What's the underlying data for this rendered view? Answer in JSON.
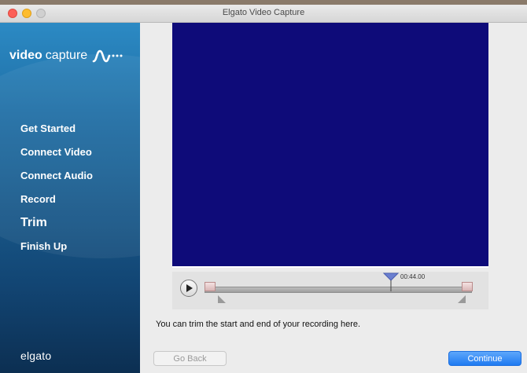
{
  "window": {
    "title": "Elgato Video Capture"
  },
  "brand": {
    "bold": "video",
    "light": "capture"
  },
  "sidebar": {
    "items": [
      {
        "label": "Get Started"
      },
      {
        "label": "Connect Video"
      },
      {
        "label": "Connect Audio"
      },
      {
        "label": "Record"
      },
      {
        "label": "Trim",
        "active": true
      },
      {
        "label": "Finish Up"
      }
    ],
    "logo": "elgato"
  },
  "video": {
    "color": "#0e0b79"
  },
  "trim": {
    "playhead_time": "00:44.00"
  },
  "hint": "You can trim the start and end of your recording here.",
  "buttons": {
    "back": "Go Back",
    "continue": "Continue"
  },
  "colors": {
    "accent": "#1f7af1",
    "sidebar_top": "#2c8ac4",
    "sidebar_bottom": "#0c2f52"
  }
}
